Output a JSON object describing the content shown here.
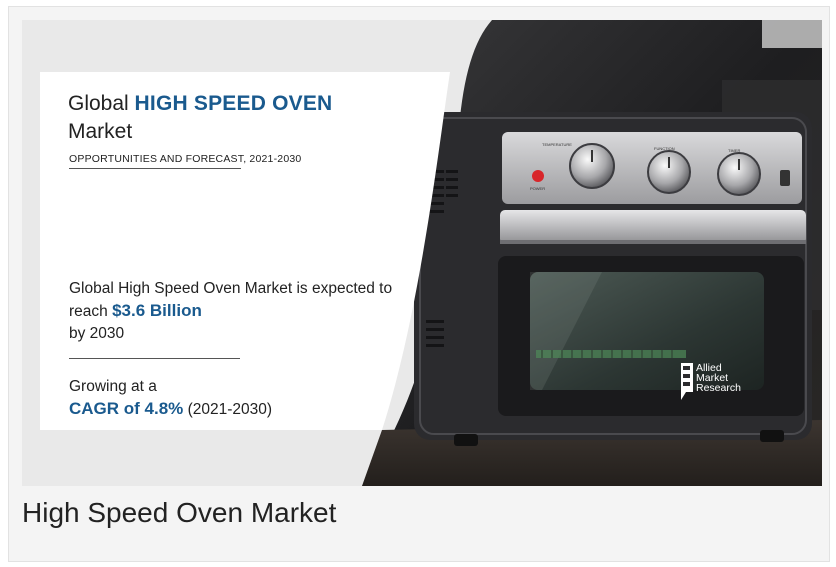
{
  "infographic": {
    "title_prefix": "Global",
    "title_highlight": "HIGH SPEED OVEN",
    "title_line2": "Market",
    "subtitle": "OPPORTUNITIES AND FORECAST, 2021-2030",
    "body_part1": "Global High Speed Oven Market is expected to reach",
    "body_value": "$3.6 Billion",
    "body_part2": "by 2030",
    "growth_prefix": "Growing at a",
    "cagr": "CAGR of 4.8%",
    "cagr_period": "(2021-2030)",
    "logo_line1": "Allied",
    "logo_line2": "Market",
    "logo_line3": "Research",
    "oven_label_temp": "TEMPERATURE",
    "oven_label_func": "FUNCTION",
    "oven_label_timer": "TIMER",
    "oven_label_power": "POWER"
  },
  "caption": "High Speed Oven Market",
  "colors": {
    "accent_blue": "#1a5a8e",
    "text_dark": "#222222",
    "oven_body": "#2b2b2e",
    "power_light": "#d8262a"
  }
}
